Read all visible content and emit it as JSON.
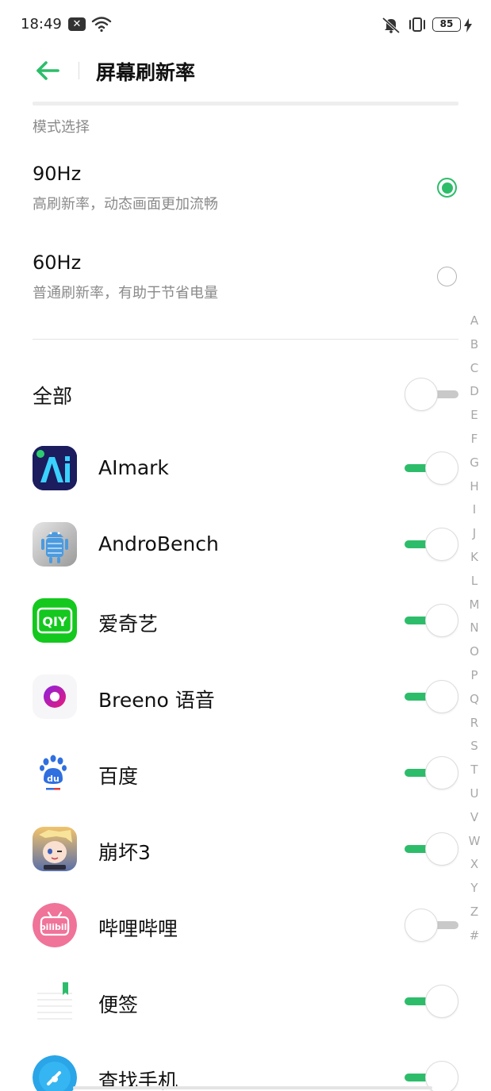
{
  "status_bar": {
    "time": "18:49",
    "notification_icon": "message-badge-icon",
    "battery": "85"
  },
  "header": {
    "title": "屏幕刷新率"
  },
  "section_label": "模式选择",
  "modes": [
    {
      "name": "90Hz",
      "desc": "高刷新率，动态画面更加流畅",
      "selected": true
    },
    {
      "name": "60Hz",
      "desc": "普通刷新率，有助于节省电量",
      "selected": false
    }
  ],
  "all_label": "全部",
  "apps": [
    {
      "name": "AImark",
      "enabled": true,
      "icon": "aimark-icon"
    },
    {
      "name": "AndroBench",
      "enabled": true,
      "icon": "androbench-icon"
    },
    {
      "name": "爱奇艺",
      "enabled": true,
      "icon": "iqiyi-icon"
    },
    {
      "name": "Breeno 语音",
      "enabled": true,
      "icon": "breeno-icon"
    },
    {
      "name": "百度",
      "enabled": true,
      "icon": "baidu-icon"
    },
    {
      "name": "崩坏3",
      "enabled": true,
      "icon": "honkai3-icon"
    },
    {
      "name": "哔哩哔哩",
      "enabled": false,
      "icon": "bilibili-icon"
    },
    {
      "name": "便签",
      "enabled": true,
      "icon": "notes-icon"
    },
    {
      "name": "查找手机",
      "enabled": true,
      "icon": "find-phone-icon"
    }
  ],
  "index_letters": [
    "A",
    "B",
    "C",
    "D",
    "E",
    "F",
    "G",
    "H",
    "I",
    "J",
    "K",
    "L",
    "M",
    "N",
    "O",
    "P",
    "Q",
    "R",
    "S",
    "T",
    "U",
    "V",
    "W",
    "X",
    "Y",
    "Z",
    "#"
  ],
  "colors": {
    "accent": "#2dbd6a",
    "secondary_text": "#8a8a8a"
  }
}
